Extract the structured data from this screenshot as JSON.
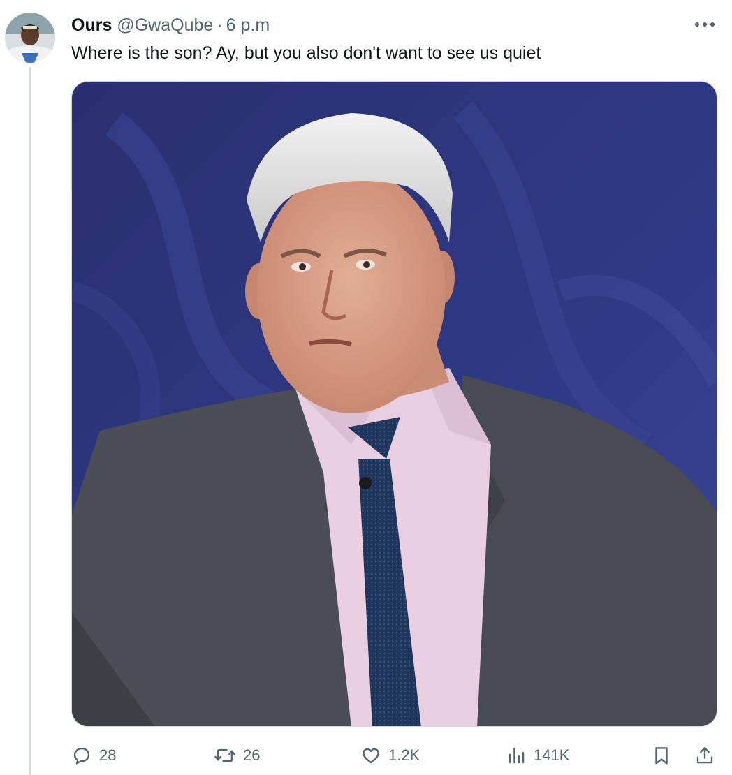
{
  "tweet": {
    "author": {
      "display_name": "Ours",
      "handle": "@GwaQube",
      "separator": "·",
      "timestamp": "6 p.m"
    },
    "text": "Where is the son? Ay, but you also don't want to see us quiet",
    "media": {
      "description": "Photo of a grey-haired man in a grey suit, pink shirt and navy tie against a blue studio background"
    },
    "actions": {
      "reply_count": "28",
      "retweet_count": "26",
      "like_count": "1.2K",
      "view_count": "141K"
    },
    "icons": {
      "reply": "reply-icon",
      "retweet": "retweet-icon",
      "like": "heart-icon",
      "views": "views-icon",
      "bookmark": "bookmark-icon",
      "share": "share-icon",
      "more": "more-icon"
    }
  },
  "colors": {
    "text_primary": "#0f1419",
    "text_secondary": "#536471",
    "thread_line": "#cfd9de",
    "photo_background": "#2c3477",
    "suit": "#4a4d52",
    "shirt": "#e9cfe0",
    "tie": "#1d3359"
  }
}
